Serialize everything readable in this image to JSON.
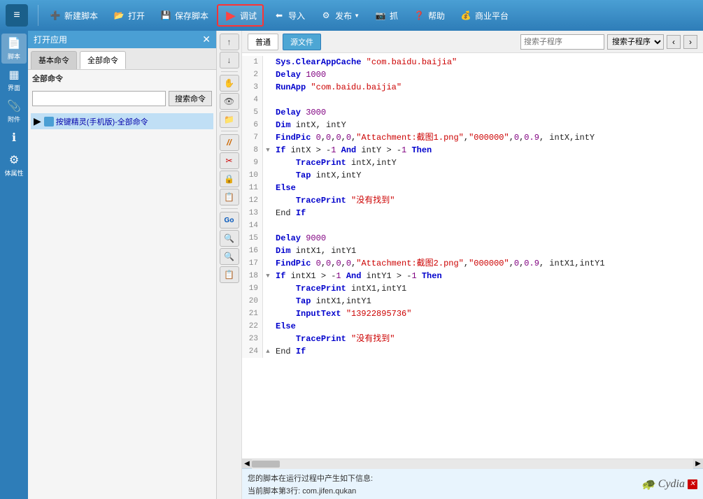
{
  "toolbar": {
    "logo_symbol": "≡",
    "buttons": [
      {
        "id": "new",
        "icon": "➕",
        "label": "新建脚本"
      },
      {
        "id": "open",
        "icon": "📂",
        "label": "打开"
      },
      {
        "id": "save",
        "icon": "💾",
        "label": "保存脚本"
      },
      {
        "id": "debug",
        "icon": "▶",
        "label": "调试",
        "active": true
      },
      {
        "id": "import",
        "icon": "⬅",
        "label": "导入"
      },
      {
        "id": "publish",
        "icon": "⚙",
        "label": "发布"
      },
      {
        "id": "capture",
        "icon": "📷",
        "label": "抓"
      },
      {
        "id": "help",
        "icon": "❓",
        "label": "帮助"
      },
      {
        "id": "platform",
        "icon": "💰",
        "label": "商业平台"
      }
    ]
  },
  "sidebar": {
    "items": [
      {
        "id": "script",
        "icon": "📄",
        "label": "脚本"
      },
      {
        "id": "interface",
        "icon": "▦",
        "label": "界面"
      },
      {
        "id": "attachment",
        "icon": "📎",
        "label": "附件"
      },
      {
        "id": "info",
        "icon": "ℹ",
        "label": ""
      },
      {
        "id": "properties",
        "icon": "⚙",
        "label": "体属性"
      }
    ]
  },
  "panel": {
    "title": "打开应用",
    "tabs": [
      "基本命令",
      "全部命令"
    ],
    "active_tab": 1,
    "category_header": "全部命令",
    "search_placeholder": "",
    "search_button": "搜索命令",
    "tree_item": "按键精灵(手机版)-全部命令"
  },
  "code_toolbar": {
    "tab_normal": "普通",
    "tab_source": "源文件",
    "search_placeholder": "搜索子程序",
    "nav_prev": "‹",
    "nav_next": "›"
  },
  "code": {
    "lines": [
      {
        "num": 1,
        "indent": 0,
        "marker": "",
        "text": "Sys.ClearAppCache \"com.baidu.baijia\""
      },
      {
        "num": 2,
        "indent": 0,
        "marker": "",
        "text": "Delay 1000"
      },
      {
        "num": 3,
        "indent": 0,
        "marker": "",
        "text": "RunApp \"com.baidu.baijia\""
      },
      {
        "num": 4,
        "indent": 0,
        "marker": "",
        "text": ""
      },
      {
        "num": 5,
        "indent": 0,
        "marker": "",
        "text": "Delay 3000"
      },
      {
        "num": 6,
        "indent": 0,
        "marker": "",
        "text": "Dim intX, intY"
      },
      {
        "num": 7,
        "indent": 0,
        "marker": "",
        "text": "FindPic 0,0,0,0,\"Attachment:截图1.png\",\"000000\",0,0.9, intX,intY"
      },
      {
        "num": 8,
        "indent": 0,
        "marker": "▼",
        "text": "If intX > -1 And intY > -1 Then"
      },
      {
        "num": 9,
        "indent": 1,
        "marker": "",
        "text": "TracePrint intX,intY"
      },
      {
        "num": 10,
        "indent": 1,
        "marker": "",
        "text": "Tap intX,intY"
      },
      {
        "num": 11,
        "indent": 0,
        "marker": "",
        "text": "Else"
      },
      {
        "num": 12,
        "indent": 1,
        "marker": "",
        "text": "TracePrint \"没有找到\""
      },
      {
        "num": 13,
        "indent": 0,
        "marker": "",
        "text": "End If"
      },
      {
        "num": 14,
        "indent": 0,
        "marker": "",
        "text": ""
      },
      {
        "num": 15,
        "indent": 0,
        "marker": "",
        "text": "Delay 9000"
      },
      {
        "num": 16,
        "indent": 0,
        "marker": "",
        "text": "Dim intX1, intY1"
      },
      {
        "num": 17,
        "indent": 0,
        "marker": "",
        "text": "FindPic 0,0,0,0,\"Attachment:截图2.png\",\"000000\",0,0.9, intX1,intY1"
      },
      {
        "num": 18,
        "indent": 0,
        "marker": "▼",
        "text": "If intX1 > -1 And intY1 > -1 Then"
      },
      {
        "num": 19,
        "indent": 1,
        "marker": "",
        "text": "TracePrint intX1,intY1"
      },
      {
        "num": 20,
        "indent": 1,
        "marker": "",
        "text": "Tap intX1,intY1"
      },
      {
        "num": 21,
        "indent": 1,
        "marker": "",
        "text": "InputText \"13922895736\""
      },
      {
        "num": 22,
        "indent": 0,
        "marker": "",
        "text": "Else"
      },
      {
        "num": 23,
        "indent": 1,
        "marker": "",
        "text": "TracePrint \"没有找到\""
      },
      {
        "num": 24,
        "indent": 0,
        "marker": "▲",
        "text": "End If"
      }
    ]
  },
  "status": {
    "line1": "您的脚本在运行过程中产生如下信息:",
    "line2": "当前脚本第3行: com.jifen.qukan"
  },
  "mid_buttons": [
    "↑",
    "↓",
    "✋",
    "👁",
    "📁",
    "//",
    "✂",
    "🔒",
    "📋",
    "Go",
    "🔍",
    "🔍",
    "📋"
  ],
  "colors": {
    "toolbar_bg": "#3a8cc4",
    "sidebar_bg": "#2e7db8",
    "accent": "#4a9fd4",
    "debug_border": "#ff3333"
  }
}
